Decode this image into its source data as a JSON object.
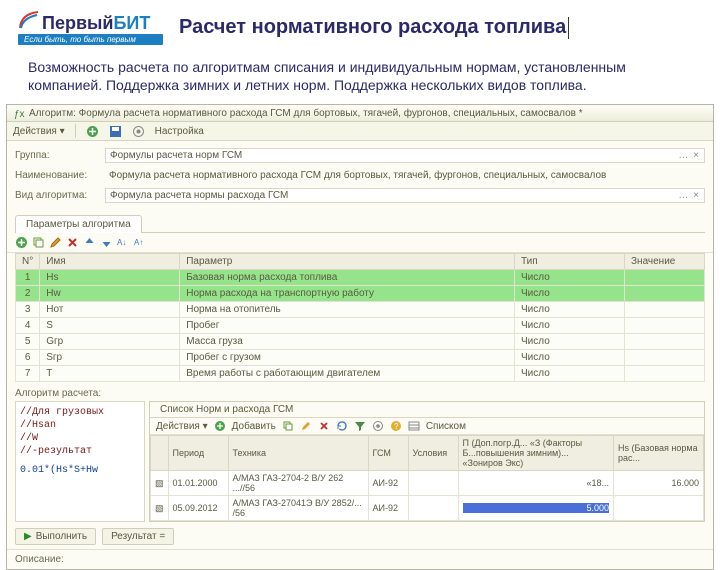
{
  "logo": {
    "brand_a": "Первый",
    "brand_b": "БИТ",
    "tagline": "Если быть, то быть первым"
  },
  "title": "Расчет нормативного расхода топлива",
  "subtitle": "Возможность расчета по алгоритмам списания и индивидуальным нормам, установленным компанией. Поддержка зимних и летних норм. Поддержка нескольких видов топлива.",
  "window": {
    "caption": "Алгоритм: Формула расчета нормативного расхода ГСМ для бортовых, тягачей, фургонов, специальных, самосвалов *",
    "toolbar": {
      "actions": "Действия ▾",
      "settings": "Настройка"
    }
  },
  "form": {
    "group_lbl": "Группа:",
    "group_val": "Формулы расчета норм ГСМ",
    "name_lbl": "Наименование:",
    "name_val": "Формула расчета нормативного расхода ГСМ для бортовых, тягачей, фургонов, специальных, самосвалов",
    "kind_lbl": "Вид алгоритма:",
    "kind_val": "Формула расчета нормы расхода ГСМ"
  },
  "tabs": {
    "a": "Параметры алгоритма"
  },
  "paramTable": {
    "cols": {
      "n": "N°",
      "name": "Имя",
      "param": "Параметр",
      "type": "Тип",
      "value": "Значение"
    },
    "rows": [
      {
        "n": "1",
        "name": "Hs",
        "param": "Базовая норма расхода топлива",
        "type": "Число"
      },
      {
        "n": "2",
        "name": "Hw",
        "param": "Норма расхода на транспортную работу",
        "type": "Число"
      },
      {
        "n": "3",
        "name": "Hот",
        "param": "Норма на отопитель",
        "type": "Число"
      },
      {
        "n": "4",
        "name": "S",
        "param": "Пробег",
        "type": "Число"
      },
      {
        "n": "5",
        "name": "Gгр",
        "param": "Масса груза",
        "type": "Число"
      },
      {
        "n": "6",
        "name": "Sгр",
        "param": "Пробег с грузом",
        "type": "Число"
      },
      {
        "n": "7",
        "name": "T",
        "param": "Время работы с работающим двигателем",
        "type": "Число"
      }
    ]
  },
  "algoLabel": "Алгоритм расчета:",
  "code": {
    "l1": "//Для грузовых",
    "l2": "//Нsan",
    "l3": "//W",
    "l4": "//-результат",
    "l5": "0.01*(Hs*S+Hw"
  },
  "list": {
    "caption": "Список Норм и расхода ГСМ",
    "toolbar": {
      "actions": "Действия ▾",
      "add": "Добавить",
      "mode": "Списком"
    },
    "cols": {
      "period": "Период",
      "tech": "Техника",
      "gsm": "ГСМ",
      "cond": "Условия",
      "extra": "П (Доп.погр.Д... «З (Факторы Б...повышения зимним)... «Зониров Экс)",
      "hs": "Hs (Базовая норма рас..."
    },
    "rows": [
      {
        "period": "01.01.2000",
        "tech": "А/МАЗ ГАЗ-2704-2  В/У 262 ...//56",
        "gsm": "АИ-92",
        "cond": "",
        "extra": "«18...",
        "hs": "16.000"
      },
      {
        "period": "05.09.2012",
        "tech": "А/МАЗ ГАЗ-27041Э  В/У 2852/... /56",
        "gsm": "АИ-92",
        "cond": "",
        "extra": "",
        "hs": ""
      }
    ],
    "sel_value": "5.000"
  },
  "bottom": {
    "run": "Выполнить",
    "result_tab": "Результат =",
    "desc": "Описание:"
  }
}
